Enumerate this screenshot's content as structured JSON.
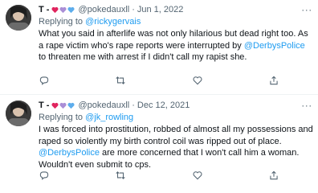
{
  "tweets": [
    {
      "name": "T -",
      "handle": "@pokedauxll",
      "date": "Jun 1, 2022",
      "reply_prefix": "Replying to ",
      "reply_to": "@rickygervais",
      "body_parts": [
        "What you said in afterlife was not only hilarious but dead right too. As a rape victim who's rape reports were interrupted by ",
        "@DerbysPolice",
        " to threaten me with arrest if I didn't call my rapist she."
      ]
    },
    {
      "name": "T -",
      "handle": "@pokedauxll",
      "date": "Dec 12, 2021",
      "reply_prefix": "Replying to ",
      "reply_to": "@jk_rowling",
      "body_parts": [
        "I was forced into prostitution, robbed of almost all my possessions and raped so violently my birth control coil was ripped out of place. ",
        "@DerbysPolice",
        " are more concerned that I won't call him a woman. Wouldn't even submit to cps."
      ]
    }
  ],
  "separator": "·",
  "more_label": "···",
  "colors": {
    "link": "#1d9bf0",
    "muted": "#536471",
    "text": "#0f1419",
    "heart_red": "#e0245e",
    "heart_purple": "#aa8ed6",
    "heart_blue": "#5dadec"
  },
  "icons": [
    "reply-icon",
    "retweet-icon",
    "like-icon",
    "share-icon"
  ]
}
